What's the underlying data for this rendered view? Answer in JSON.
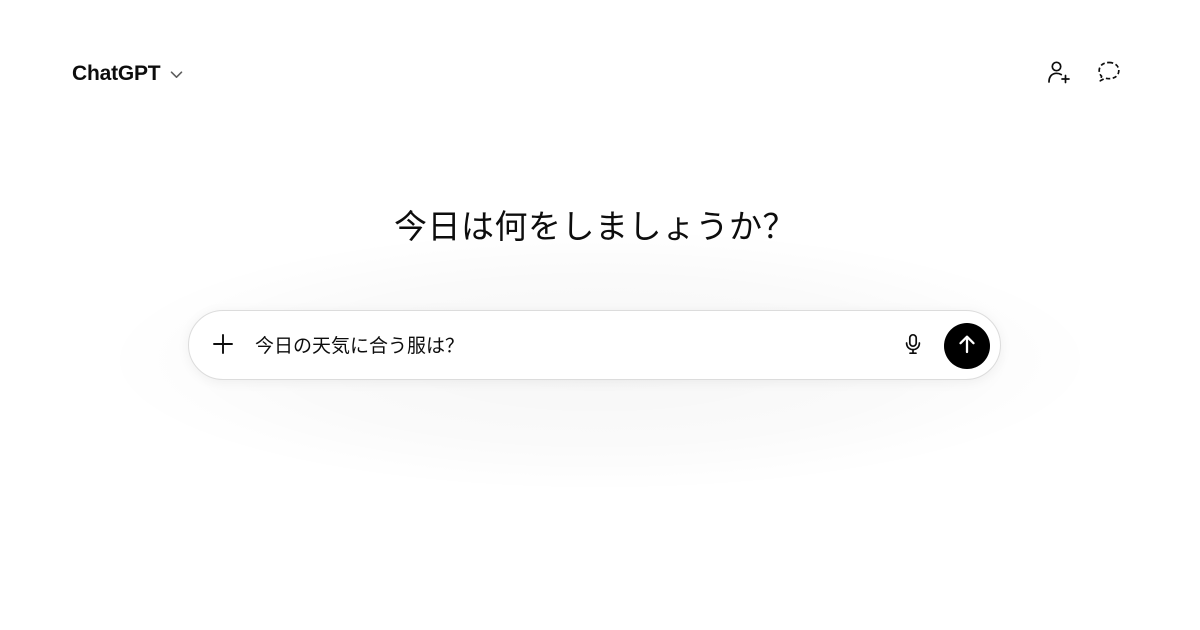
{
  "header": {
    "model_name": "ChatGPT",
    "icons": {
      "model_chevron": "chevron-down-icon",
      "add_people": "person-plus-icon",
      "temporary_chat": "dashed-chat-bubble-icon"
    }
  },
  "main": {
    "headline": "今日は何をしましょうか？"
  },
  "composer": {
    "input_text": "今日の天気に合う服は？",
    "icons": {
      "attach": "plus-icon",
      "voice": "microphone-icon",
      "send": "arrow-up-icon"
    }
  },
  "colors": {
    "background": "#ffffff",
    "text": "#0d0d0d",
    "send_button": "#000000",
    "composer_border": "#dcdcdc"
  }
}
